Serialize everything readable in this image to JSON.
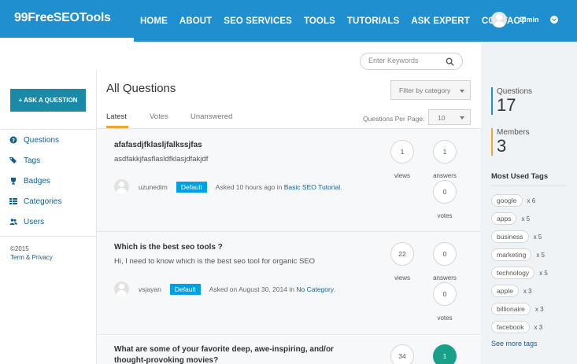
{
  "header": {
    "logo": "99FreeSEOTools",
    "nav": [
      "HOME",
      "ABOUT",
      "SEO SERVICES",
      "TOOLS",
      "TUTORIALS",
      "ASK EXPERT",
      "CONTACT"
    ],
    "user_name": "admin"
  },
  "search": {
    "placeholder": "Enter Keywords"
  },
  "left": {
    "ask_button": "+ ASK A QUESTION",
    "nav": [
      "Questions",
      "Tags",
      "Badges",
      "Categories",
      "Users"
    ],
    "copyright": "©2015",
    "terms": "Term & Privacy"
  },
  "main": {
    "title": "All Questions",
    "filter_placeholder": "Filter by category",
    "tabs": [
      "Latest",
      "Votes",
      "Unanswered"
    ],
    "per_page_label": "Questions Per Page:",
    "per_page_value": "10",
    "questions": [
      {
        "title": "afafasdjfklasljfalkssjfas",
        "excerpt": "asdfakkjfasflasldfklasjdfakjdf",
        "user": "uzunedim",
        "badge": "Default",
        "asked": "Asked 10 hours ago in",
        "category": "Basic SEO Tutorial",
        "views": "1",
        "answers": "1",
        "votes": "0",
        "views_label": "views",
        "answers_label": "answers",
        "votes_label": "votes"
      },
      {
        "title": "Which is the best seo tools ?",
        "excerpt": "Hi, I need to know which is the best seo tool for organic SEO",
        "user": "vsjayan",
        "badge": "Default",
        "asked": "Asked on August 30, 2014 in",
        "category": "No Category",
        "views": "22",
        "answers": "0",
        "votes": "0",
        "views_label": "views",
        "answers_label": "answers",
        "votes_label": "votes"
      },
      {
        "title": "What are some of your favorite deep, awe-inspiring, and/or thought-provoking movies?",
        "views": "34",
        "answers": "1"
      }
    ]
  },
  "right": {
    "questions_label": "Questions",
    "questions_count": "17",
    "members_label": "Members",
    "members_count": "3",
    "used_tags_title": "Most Used Tags",
    "tags": [
      {
        "name": "google",
        "count": "x 6"
      },
      {
        "name": "apps",
        "count": "x 5"
      },
      {
        "name": "business",
        "count": "x 5"
      },
      {
        "name": "marketing",
        "count": "x 5"
      },
      {
        "name": "technology",
        "count": "x 5"
      },
      {
        "name": "apple",
        "count": "x 3"
      },
      {
        "name": "billionaire",
        "count": "x 3"
      },
      {
        "name": "facebook",
        "count": "x 3"
      }
    ],
    "see_more": "See more tags"
  },
  "colors": {
    "header_blue": "#1f8fd0",
    "accent_orange": "#f1a531",
    "badge_blue": "#00a0e4",
    "answered_green": "#1aa08a"
  }
}
